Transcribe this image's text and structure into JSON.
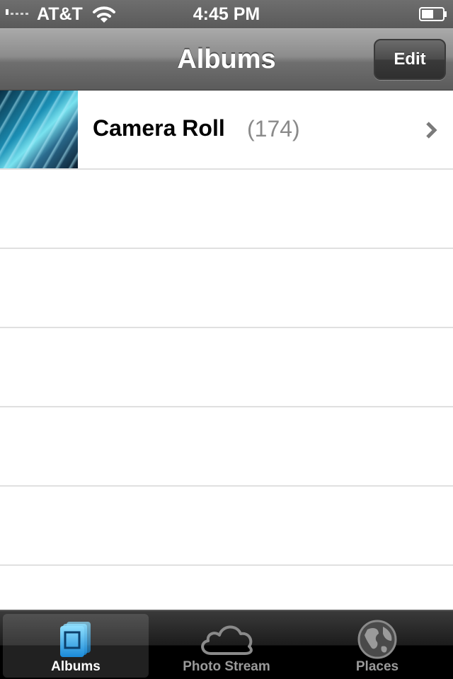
{
  "status_bar": {
    "carrier": "AT&T",
    "time": "4:45 PM"
  },
  "nav_bar": {
    "title": "Albums",
    "edit_label": "Edit"
  },
  "albums": [
    {
      "name": "Camera Roll",
      "count": "(174)"
    }
  ],
  "tab_bar": {
    "tabs": [
      {
        "label": "Albums",
        "icon": "albums-icon",
        "selected": true
      },
      {
        "label": "Photo Stream",
        "icon": "cloud-icon",
        "selected": false
      },
      {
        "label": "Places",
        "icon": "globe-icon",
        "selected": false
      }
    ]
  },
  "colors": {
    "nav_gradient_top": "#a9a9a9",
    "nav_gradient_bottom": "#5b5b5b",
    "count_text": "#8a8a8a",
    "tab_selected_icon": "#5ac8fa"
  }
}
